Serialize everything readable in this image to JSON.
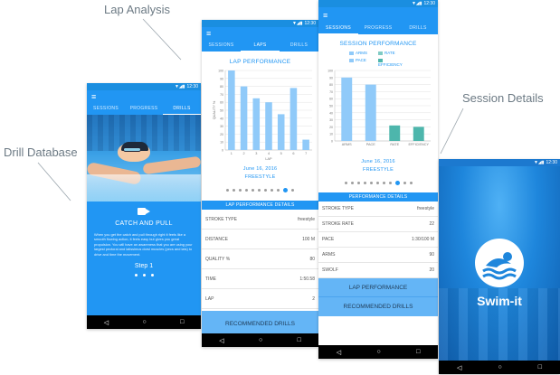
{
  "callouts": {
    "lap_analysis": "Lap Analysis",
    "session_details": "Session Details",
    "drill_database": "Drill Database"
  },
  "status_time": "12:30",
  "tabs_main": [
    "SESSIONS",
    "PROGRESS",
    "DRILLS"
  ],
  "tabs_laps": [
    "SESSIONS",
    "LAPS",
    "DRILLS"
  ],
  "drill_screen": {
    "title": "CATCH AND PULL",
    "description": "When you get the catch and pull through right it feels like a smooth flowing action, it feels easy but gives you great propulsion. You will have an awareness that you are using your largest pectoral and latissimus dorsi muscles (pecs and lats) to drive and time the movement.",
    "step": "Step 1",
    "video_icon": "video-camera-icon"
  },
  "lap_screen": {
    "title": "LAP PERFORMANCE",
    "date": "June 16, 2016",
    "style": "FREESTYLE",
    "details_header": "LAP PERFORMANCE DETAILS",
    "rows": [
      {
        "label": "STROKE TYPE",
        "value": "freestyle"
      },
      {
        "label": "DISTANCE",
        "value": "100 M"
      },
      {
        "label": "QUALITY %",
        "value": "80"
      },
      {
        "label": "TIME",
        "value": "1:50.58"
      },
      {
        "label": "LAP",
        "value": "2"
      }
    ],
    "button": "RECOMMENDED DRILLS",
    "pager_count": 11,
    "pager_active": 9
  },
  "session_screen": {
    "title": "SESSION PERFORMANCE",
    "date": "June 16, 2016",
    "style": "FREESTYLE",
    "details_header": "PERFORMANCE DETAILS",
    "rows": [
      {
        "label": "STROKE TYPE",
        "value": "freestyle"
      },
      {
        "label": "STROKE RATE",
        "value": "22"
      },
      {
        "label": "PACE",
        "value": "1:30/100 M"
      },
      {
        "label": "ARMS",
        "value": "90"
      },
      {
        "label": "SWOLF",
        "value": "20"
      }
    ],
    "button_1": "LAP PERFORMANCE",
    "button_2": "RECOMMENDED DRILLS",
    "pager_count": 11,
    "pager_active": 8
  },
  "splash": {
    "app_name": "Swim-it"
  },
  "colors": {
    "primary": "#2196f3",
    "bar_light": "#90caf9",
    "bar_teal": "#4db6ac",
    "navbar": "#000000"
  },
  "chart_data": [
    {
      "type": "bar",
      "title": "LAP PERFORMANCE",
      "ylabel": "QUALITY %",
      "xlabel": "LAP",
      "categories": [
        "1",
        "2",
        "3",
        "4",
        "5",
        "6",
        "7"
      ],
      "values": [
        100,
        80,
        65,
        60,
        45,
        78,
        13
      ],
      "highlight_index": 1,
      "ylim": [
        0,
        100
      ],
      "yticks": [
        0,
        10,
        20,
        30,
        40,
        50,
        60,
        70,
        80,
        90,
        100
      ],
      "grid": true
    },
    {
      "type": "bar",
      "title": "SESSION PERFORMANCE",
      "categories": [
        "ARMS",
        "PACE",
        "RATE",
        "EFFICIENCY"
      ],
      "values": [
        90,
        80,
        22,
        20
      ],
      "legend": [
        "ARMS",
        "RATE",
        "PACE",
        "EFFICIENCY"
      ],
      "legend_placement": "top",
      "ylim": [
        0,
        100
      ],
      "yticks": [
        0,
        10,
        20,
        30,
        40,
        50,
        60,
        70,
        80,
        90,
        100
      ],
      "grid": true
    }
  ]
}
